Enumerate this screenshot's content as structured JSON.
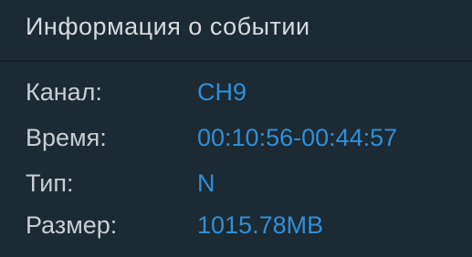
{
  "dialog": {
    "title": "Информация о событии"
  },
  "fields": [
    {
      "label": "Канал:",
      "value": "CH9"
    },
    {
      "label": "Время:",
      "value": "00:10:56-00:44:57"
    },
    {
      "label": "Тип:",
      "value": "N"
    },
    {
      "label": "Размер:",
      "value": "1015.78MB"
    }
  ],
  "colors": {
    "background": "#1c2a33",
    "label_text": "#c9ced2",
    "value_text": "#2f8fd8"
  }
}
